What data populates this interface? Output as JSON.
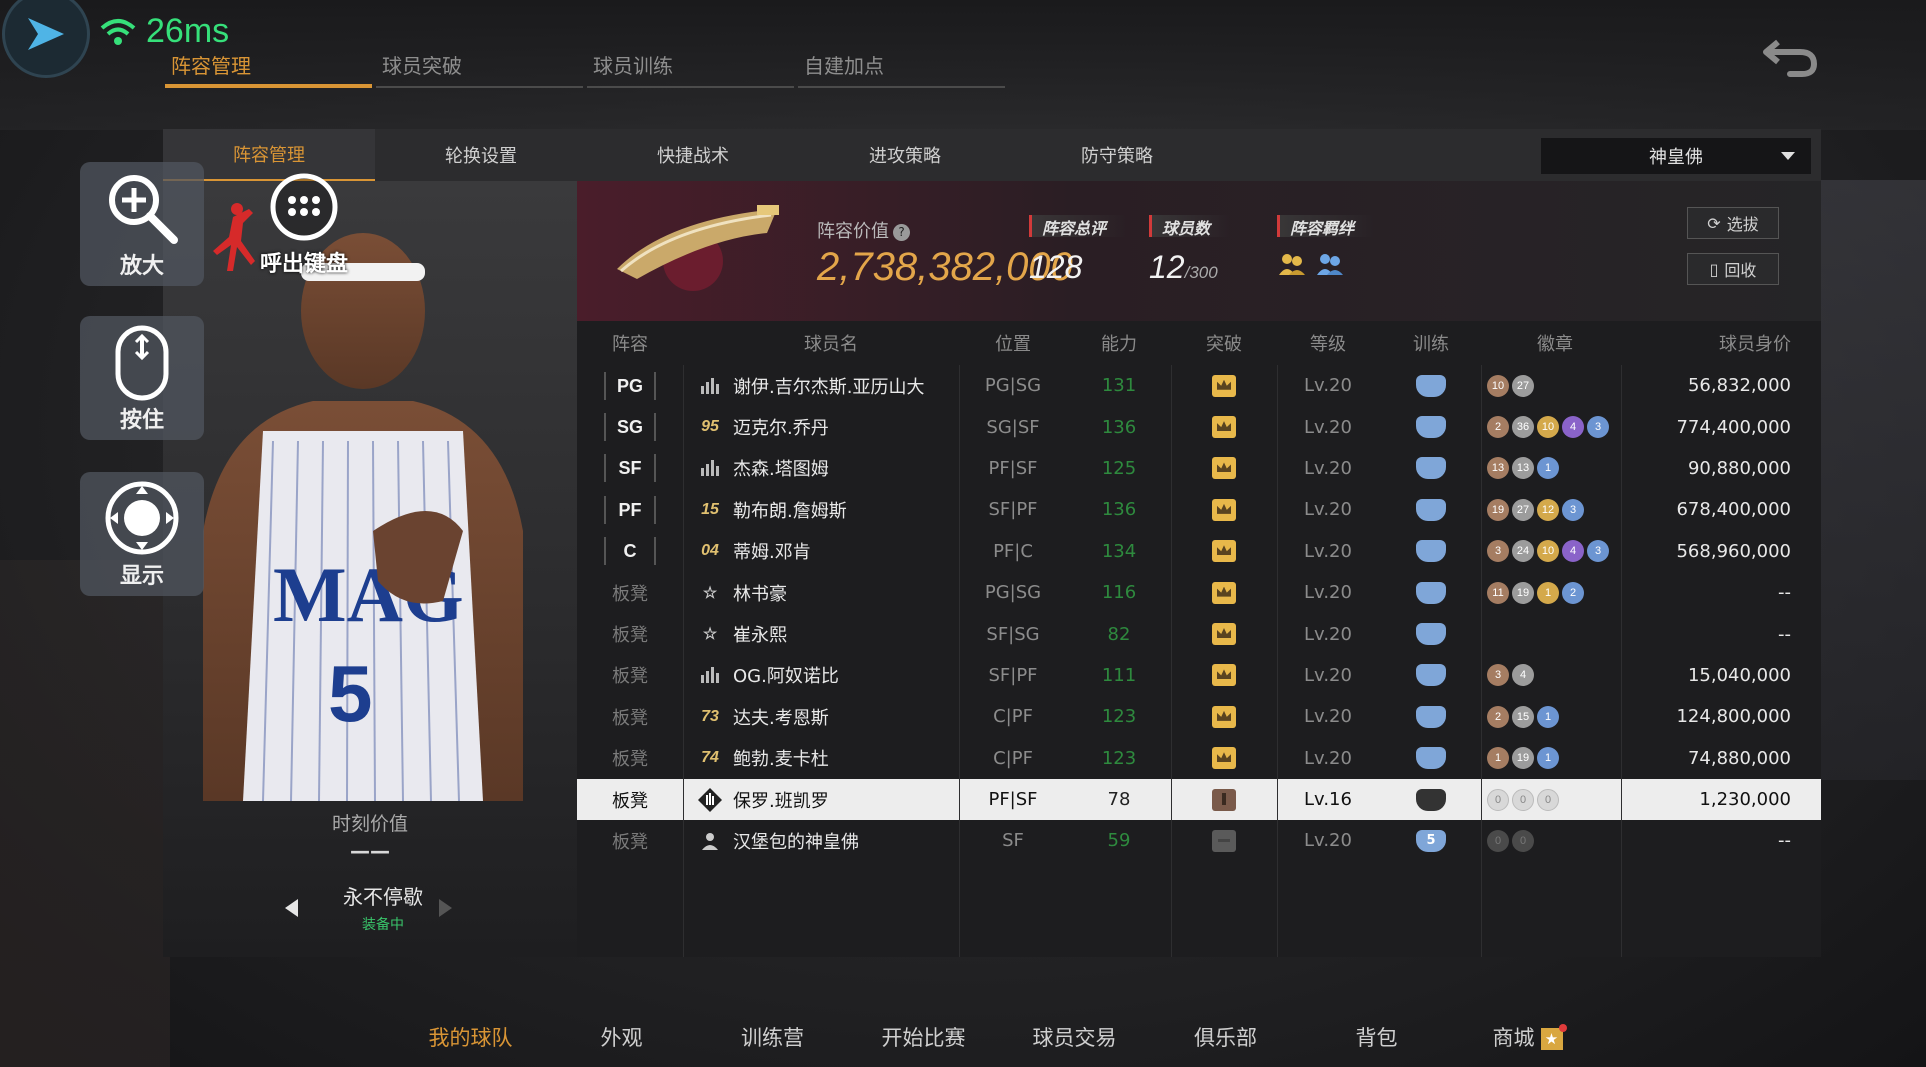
{
  "status": {
    "ping": "26ms"
  },
  "top_tabs": [
    {
      "label": "阵容管理",
      "active": true
    },
    {
      "label": "球员突破",
      "active": false
    },
    {
      "label": "球员训练",
      "active": false
    },
    {
      "label": "自建加点",
      "active": false
    }
  ],
  "side_keys": {
    "zoom": "放大",
    "hold": "按住",
    "show": "显示",
    "keyboard": "呼出键盘"
  },
  "sub_tabs": [
    {
      "label": "阵容管理",
      "active": true
    },
    {
      "label": "轮换设置",
      "active": false
    },
    {
      "label": "快捷战术",
      "active": false
    },
    {
      "label": "进攻策略",
      "active": false
    },
    {
      "label": "防守策略",
      "active": false
    }
  ],
  "team_select": "神皇佛",
  "player_card": {
    "moment_label": "时刻价值",
    "moment_value": "——",
    "celebration": "永不停歇",
    "equipped": "装备中"
  },
  "team": {
    "value_label": "阵容价值",
    "value": "2,738,382,000",
    "rating_label": "阵容总评",
    "rating": "128",
    "count_label": "球员数",
    "count": "12",
    "count_max": "/300",
    "bond_label": "阵容羁绊",
    "select_btn": "选拔",
    "recycle_btn": "回收"
  },
  "table": {
    "headers": {
      "pos": "阵容",
      "name": "球员名",
      "position": "位置",
      "ability": "能力",
      "break": "突破",
      "level": "等级",
      "train": "训练",
      "badge": "徽章",
      "price": "球员身价"
    },
    "rows": [
      {
        "slot": "PG",
        "num": "bars",
        "name": "谢伊.吉尔杰斯.亚历山大",
        "position": "PG|SG",
        "ability": "131",
        "break": "gold",
        "level": "Lv.20",
        "train": "",
        "badges": [
          [
            "10",
            "b-bronze"
          ],
          [
            "27",
            "b-silver"
          ]
        ],
        "price": "56,832,000"
      },
      {
        "slot": "SG",
        "num": "95",
        "name": "迈克尔.乔丹",
        "position": "SG|SF",
        "ability": "136",
        "break": "gold",
        "level": "Lv.20",
        "train": "",
        "badges": [
          [
            "2",
            "b-bronze"
          ],
          [
            "36",
            "b-silver"
          ],
          [
            "10",
            "b-gold"
          ],
          [
            "4",
            "b-purple"
          ],
          [
            "3",
            "b-blue"
          ]
        ],
        "price": "774,400,000"
      },
      {
        "slot": "SF",
        "num": "bars",
        "name": "杰森.塔图姆",
        "position": "PF|SF",
        "ability": "125",
        "break": "gold",
        "level": "Lv.20",
        "train": "",
        "badges": [
          [
            "13",
            "b-bronze"
          ],
          [
            "13",
            "b-silver"
          ],
          [
            "1",
            "b-blue"
          ]
        ],
        "price": "90,880,000"
      },
      {
        "slot": "PF",
        "num": "15",
        "name": "勒布朗.詹姆斯",
        "position": "SF|PF",
        "ability": "136",
        "break": "gold",
        "level": "Lv.20",
        "train": "",
        "badges": [
          [
            "19",
            "b-bronze"
          ],
          [
            "27",
            "b-silver"
          ],
          [
            "12",
            "b-gold"
          ],
          [
            "3",
            "b-blue"
          ]
        ],
        "price": "678,400,000"
      },
      {
        "slot": "C",
        "num": "04",
        "name": "蒂姆.邓肯",
        "position": "PF|C",
        "ability": "134",
        "break": "gold",
        "level": "Lv.20",
        "train": "",
        "badges": [
          [
            "3",
            "b-bronze"
          ],
          [
            "24",
            "b-silver"
          ],
          [
            "10",
            "b-gold"
          ],
          [
            "4",
            "b-purple"
          ],
          [
            "3",
            "b-blue"
          ]
        ],
        "price": "568,960,000"
      },
      {
        "slot": "板凳",
        "num": "star",
        "name": "林书豪",
        "position": "PG|SG",
        "ability": "116",
        "break": "gold",
        "level": "Lv.20",
        "train": "",
        "badges": [
          [
            "11",
            "b-bronze"
          ],
          [
            "19",
            "b-silver"
          ],
          [
            "1",
            "b-gold"
          ],
          [
            "2",
            "b-blue"
          ]
        ],
        "price": "--"
      },
      {
        "slot": "板凳",
        "num": "star",
        "name": "崔永熙",
        "position": "SF|SG",
        "ability": "82",
        "break": "gold",
        "level": "Lv.20",
        "train": "",
        "badges": [],
        "price": "--"
      },
      {
        "slot": "板凳",
        "num": "bars",
        "name": "OG.阿奴诺比",
        "position": "SF|PF",
        "ability": "111",
        "break": "gold",
        "level": "Lv.20",
        "train": "",
        "badges": [
          [
            "3",
            "b-bronze"
          ],
          [
            "4",
            "b-silver"
          ]
        ],
        "price": "15,040,000"
      },
      {
        "slot": "板凳",
        "num": "73",
        "name": "达夫.考恩斯",
        "position": "C|PF",
        "ability": "123",
        "break": "gold",
        "level": "Lv.20",
        "train": "",
        "badges": [
          [
            "2",
            "b-bronze"
          ],
          [
            "15",
            "b-silver"
          ],
          [
            "1",
            "b-blue"
          ]
        ],
        "price": "124,800,000"
      },
      {
        "slot": "板凳",
        "num": "74",
        "name": "鲍勃.麦卡杜",
        "position": "C|PF",
        "ability": "123",
        "break": "gold",
        "level": "Lv.20",
        "train": "",
        "badges": [
          [
            "1",
            "b-bronze"
          ],
          [
            "19",
            "b-silver"
          ],
          [
            "1",
            "b-blue"
          ]
        ],
        "price": "74,880,000"
      },
      {
        "slot": "板凳",
        "num": "diamond",
        "name": "保罗.班凯罗",
        "position": "PF|SF",
        "ability": "78",
        "break": "brown",
        "level": "Lv.16",
        "train": "",
        "badges": [
          [
            "0",
            "b-empty"
          ],
          [
            "0",
            "b-empty"
          ],
          [
            "0",
            "b-empty"
          ]
        ],
        "price": "1,230,000"
      },
      {
        "slot": "板凳",
        "num": "person",
        "name": "汉堡包的神皇佛",
        "position": "SF",
        "ability": "59",
        "break": "grey",
        "level": "Lv.20",
        "train": "5",
        "badges": [
          [
            "0",
            "b-grey"
          ],
          [
            "0",
            "b-grey"
          ]
        ],
        "price": "--"
      }
    ]
  },
  "bottom_nav": [
    {
      "label": "我的球队",
      "active": true
    },
    {
      "label": "外观",
      "active": false
    },
    {
      "label": "训练营",
      "active": false
    },
    {
      "label": "开始比赛",
      "active": false
    },
    {
      "label": "球员交易",
      "active": false
    },
    {
      "label": "俱乐部",
      "active": false
    },
    {
      "label": "背包",
      "active": false
    },
    {
      "label": "商城",
      "active": false
    }
  ],
  "colors": {
    "accent": "#d99535",
    "ping": "#36e07a",
    "ability_green": "#2e8a3e",
    "gold_value": "#e3a64a"
  }
}
